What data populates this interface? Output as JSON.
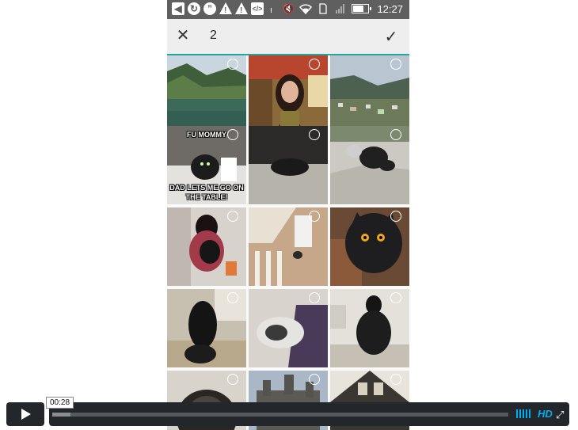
{
  "status_bar": {
    "time": "12:27",
    "icons": [
      "back-icon",
      "sync-icon",
      "hangouts-icon",
      "warning-icon",
      "warning-icon",
      "code-icon",
      "bluetooth-icon",
      "mute-icon",
      "wifi-icon",
      "sd-card-icon",
      "signal-icon",
      "battery-icon"
    ],
    "battery_level": 0.7
  },
  "toolbar": {
    "close_icon": "close-icon",
    "selected_count": "2",
    "confirm_icon": "check-icon"
  },
  "grid": {
    "tiles": [
      {
        "name": "lake-mountain-photo"
      },
      {
        "name": "woman-portrait-photo"
      },
      {
        "name": "village-valley-photo"
      },
      {
        "name": "cat-meme-photo",
        "caption_top": "FU MOMMY",
        "caption_bottom": "DAD LETS ME GO ON THE TABLE!"
      },
      {
        "name": "cat-on-carpet-photo"
      },
      {
        "name": "cat-on-stairs-photo"
      },
      {
        "name": "woman-hugging-cat-photo"
      },
      {
        "name": "staircase-cat-photo"
      },
      {
        "name": "cat-closeup-photo"
      },
      {
        "name": "person-holding-cat-photo"
      },
      {
        "name": "cat-sleeping-blanket-photo"
      },
      {
        "name": "woman-kneeling-cat-photo"
      },
      {
        "name": "fluffy-cat-photo"
      },
      {
        "name": "castle-photo"
      },
      {
        "name": "room-interior-photo"
      }
    ]
  },
  "player": {
    "time": "00:28",
    "progress": 0.04,
    "hd_label": "HD"
  }
}
